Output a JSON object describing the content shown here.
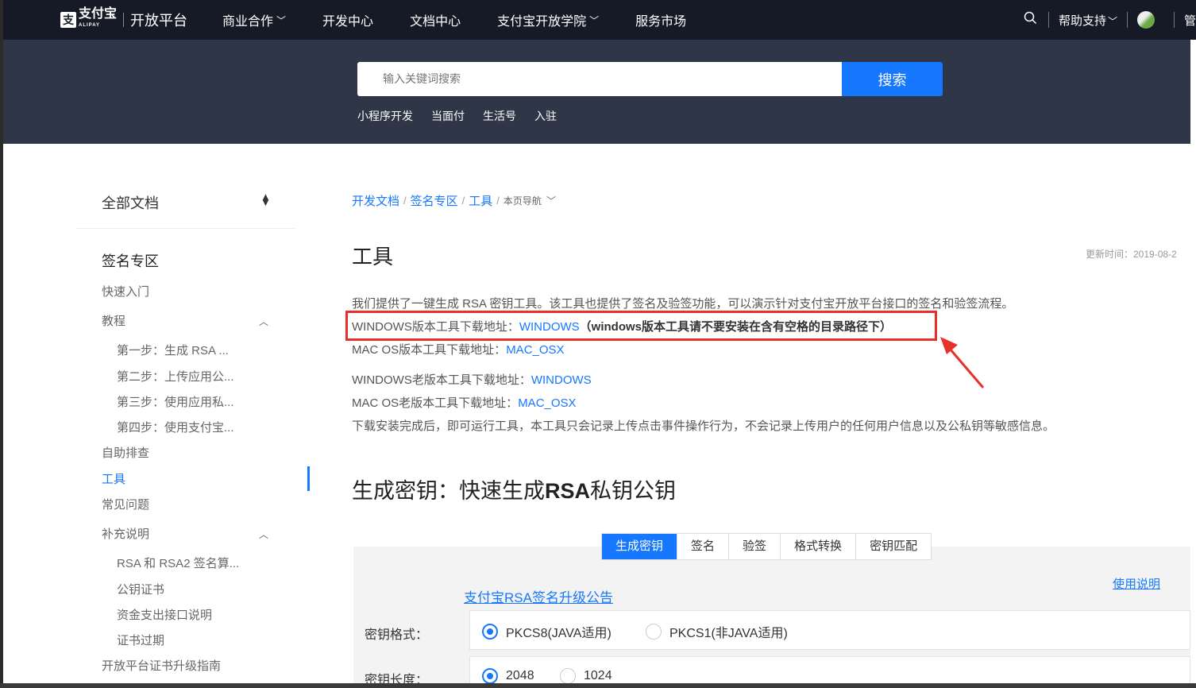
{
  "nav": {
    "logo_cn": "支付宝",
    "logo_en": "ALIPAY",
    "logo_title": "开放平台",
    "items": [
      {
        "label": "商业合作",
        "dropdown": true
      },
      {
        "label": "开发中心",
        "dropdown": false
      },
      {
        "label": "文档中心",
        "dropdown": false
      },
      {
        "label": "支付宝开放学院",
        "dropdown": true
      },
      {
        "label": "服务市场",
        "dropdown": false
      }
    ],
    "help": "帮助支持",
    "manage": "管"
  },
  "search": {
    "placeholder": "输入关键词搜索",
    "button": "搜索",
    "quick_links": [
      "小程序开发",
      "当面付",
      "生活号",
      "入驻"
    ]
  },
  "sidebar": {
    "all_docs": "全部文档",
    "section_title": "签名专区",
    "items": [
      {
        "label": "快速入门",
        "level": 1
      },
      {
        "label": "教程",
        "level": 1,
        "expanded": true
      },
      {
        "label": "第一步：生成 RSA ...",
        "level": 2
      },
      {
        "label": "第二步：上传应用公...",
        "level": 2
      },
      {
        "label": "第三步：使用应用私...",
        "level": 2
      },
      {
        "label": "第四步：使用支付宝...",
        "level": 2
      },
      {
        "label": "自助排查",
        "level": 1
      },
      {
        "label": "工具",
        "level": 1,
        "active": true
      },
      {
        "label": "常见问题",
        "level": 1
      },
      {
        "label": "补充说明",
        "level": 1,
        "expanded": true
      },
      {
        "label": "RSA 和 RSA2 签名算...",
        "level": 2
      },
      {
        "label": "公钥证书",
        "level": 2
      },
      {
        "label": "资金支出接口说明",
        "level": 2
      },
      {
        "label": "证书过期",
        "level": 2
      },
      {
        "label": "开放平台证书升级指南",
        "level": 1
      }
    ]
  },
  "breadcrumb": {
    "items": [
      "开发文档",
      "签名专区",
      "工具"
    ],
    "nav": "本页导航"
  },
  "content": {
    "title": "工具",
    "updated": "更新时间：2019-08-2",
    "intro": "我们提供了一键生成 RSA 密钥工具。该工具也提供了签名及验签功能，可以演示针对支付宝开放平台接口的签名和验签流程。",
    "win_label": "WINDOWS版本工具下载地址：",
    "win_link": "WINDOWS",
    "win_note": "（windows版本工具请不要安装在含有空格的目录路径下）",
    "mac_label": "MAC OS版本工具下载地址：",
    "mac_link": "MAC_OSX",
    "win_old_label": "WINDOWS老版本工具下载地址：",
    "win_old_link": "WINDOWS",
    "mac_old_label": "MAC OS老版本工具下载地址：",
    "mac_old_link": "MAC_OSX",
    "after_install": "下载安装完成后，即可运行工具，本工具只会记录上传点击事件操作行为，不会记录上传用户的任何用户信息以及公私钥等敏感信息。",
    "h2_prefix": "生成密钥：快速生成",
    "h2_bold": "RSA",
    "h2_suffix": "私钥公钥"
  },
  "tool": {
    "tabs": [
      {
        "label": "生成密钥",
        "active": true
      },
      {
        "label": "签名",
        "active": false
      },
      {
        "label": "验签",
        "active": false
      },
      {
        "label": "格式转换",
        "active": false
      },
      {
        "label": "密钥匹配",
        "active": false
      }
    ],
    "notice_link": "支付宝RSA签名升级公告",
    "usage_link": "使用说明",
    "key_format_label": "密钥格式：",
    "key_format_options": [
      {
        "label": "PKCS8(JAVA适用)",
        "selected": true
      },
      {
        "label": "PKCS1(非JAVA适用)",
        "selected": false
      }
    ],
    "key_length_label": "密钥长度：",
    "key_length_options": [
      {
        "label": "2048",
        "selected": true
      },
      {
        "label": "1024",
        "selected": false
      }
    ]
  },
  "colors": {
    "accent": "#1677ff",
    "nav_bg": "#151a26",
    "hero_bg": "#2f3647",
    "highlight": "#e8302a"
  }
}
